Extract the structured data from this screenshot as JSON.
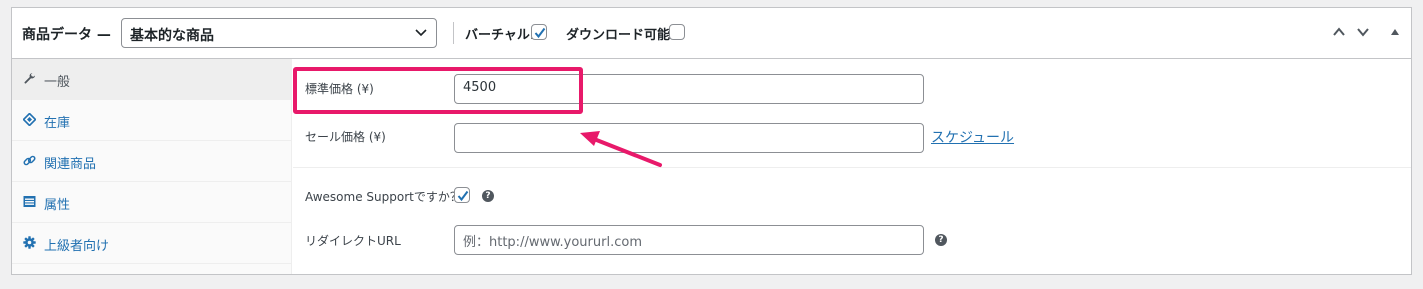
{
  "header": {
    "title": "商品データ —",
    "product_type": "基本的な商品",
    "virtual_label": "バーチャル:",
    "virtual_checked": true,
    "downloadable_label": "ダウンロード可能:",
    "downloadable_checked": false
  },
  "tabs": [
    {
      "label": "一般",
      "icon": "wrench-icon",
      "active": true
    },
    {
      "label": "在庫",
      "icon": "tag-icon",
      "active": false
    },
    {
      "label": "関連商品",
      "icon": "link-icon",
      "active": false
    },
    {
      "label": "属性",
      "icon": "list-icon",
      "active": false
    },
    {
      "label": "上級者向け",
      "icon": "gear-icon",
      "active": false
    }
  ],
  "fields": {
    "regular_price_label": "標準価格 (¥)",
    "regular_price_value": "4500",
    "sale_price_label": "セール価格 (¥)",
    "sale_price_value": "",
    "schedule_link": "スケジュール",
    "awesome_support_label": "Awesome Supportですか？",
    "awesome_support_checked": true,
    "redirect_label": "リダイレクトURL",
    "redirect_placeholder": "例：http://www.yoururl.com",
    "help_glyph": "?"
  },
  "colors": {
    "accent": "#2271b1",
    "highlight": "#e8196a"
  }
}
